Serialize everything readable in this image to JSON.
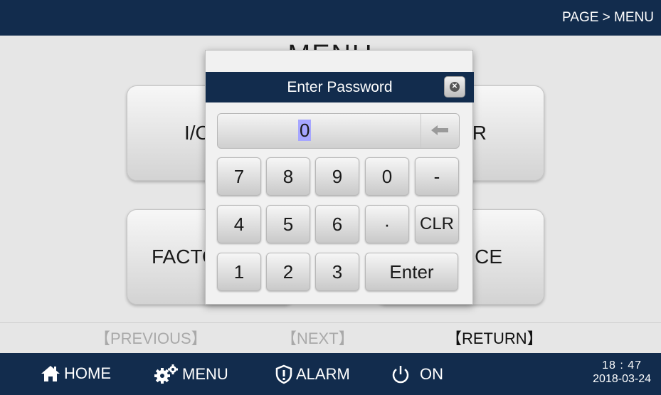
{
  "header": {
    "breadcrumb": "PAGE > MENU"
  },
  "main": {
    "title": "MENU",
    "tiles": [
      {
        "label": "I/O"
      },
      {
        "label": "USER"
      },
      {
        "label": "FACTORY"
      },
      {
        "label": "SERVICE"
      }
    ]
  },
  "nav": {
    "previous": "【PREVIOUS】",
    "next": "【NEXT】",
    "return": "【RETURN】"
  },
  "footer": {
    "home": "HOME",
    "menu": "MENU",
    "alarm": "ALARM",
    "power": "ON",
    "time": "18 : 47",
    "date": "2018-03-24"
  },
  "dialog": {
    "title": "Enter Password",
    "input_value": "0",
    "keys": [
      "7",
      "8",
      "9",
      "0",
      "-",
      "4",
      "5",
      "6",
      "·",
      "CLR",
      "1",
      "2",
      "3",
      "Enter"
    ]
  },
  "colors": {
    "bar": "#122c4d",
    "selection": "#a6a6ff"
  },
  "icons": {
    "home": "home-icon",
    "menu": "gears-icon",
    "alarm": "shield-alert-icon",
    "power": "power-icon",
    "close": "close-icon",
    "backspace": "backspace-arrow-icon"
  }
}
